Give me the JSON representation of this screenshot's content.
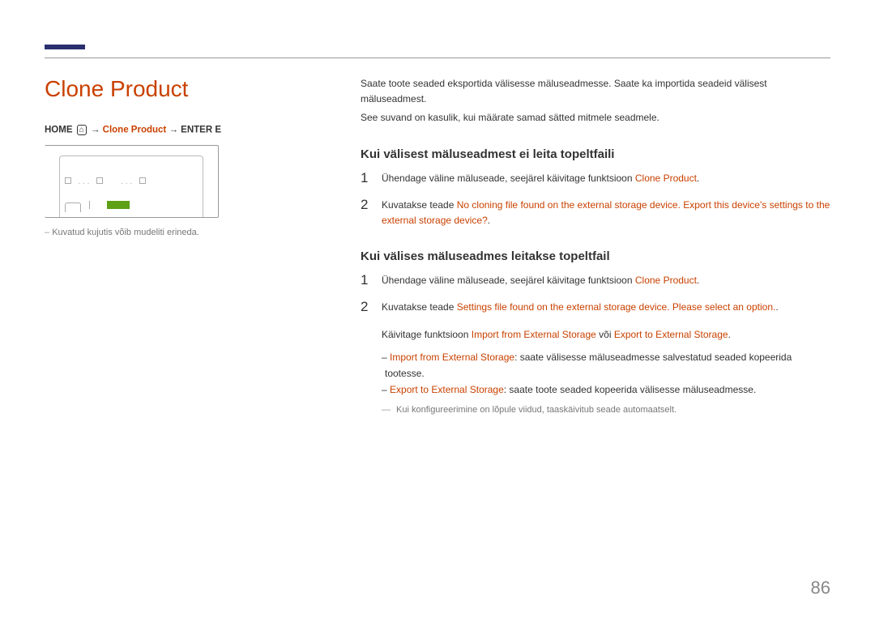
{
  "page_number": "86",
  "main_title": "Clone Product",
  "breadcrumb": {
    "home": "HOME",
    "clone_product": "Clone Product",
    "enter": "ENTER E"
  },
  "left_note": "Kuvatud kujutis võib mudeliti erineda.",
  "intro_line1": "Saate toote seaded eksportida välisesse mäluseadmesse. Saate ka importida seadeid välisest mäluseadmest.",
  "intro_line2": "See suvand on kasulik, kui määrate samad sätted mitmele seadmele.",
  "section1": {
    "heading": "Kui välisest mäluseadmest ei leita topeltfaili",
    "step1_pre": "Ühendage väline mäluseade, seejärel käivitage funktsioon ",
    "step1_orange": "Clone Product",
    "step1_post": ".",
    "step2_pre": "Kuvatakse teade ",
    "step2_orange": "No cloning file found on the external storage device. Export this device's settings to the external storage device?",
    "step2_post": "."
  },
  "section2": {
    "heading": "Kui välises mäluseadmes leitakse topeltfail",
    "step1_pre": "Ühendage väline mäluseade, seejärel käivitage funktsioon ",
    "step1_orange": "Clone Product",
    "step1_post": ".",
    "step2_pre": "Kuvatakse teade ",
    "step2_orange": "Settings file found on the external storage device. Please select an option.",
    "step2_post": ".",
    "run_text_pre": "Käivitage funktsioon ",
    "run_text_o1": "Import from External Storage",
    "run_text_mid": " või ",
    "run_text_o2": "Export to External Storage",
    "run_text_post": ".",
    "li1_o": "Import from External Storage",
    "li1_rest": ": saate välisesse mäluseadmesse salvestatud seaded kopeerida tootesse.",
    "li2_o": "Export to External Storage",
    "li2_rest": ": saate toote seaded kopeerida välisesse mäluseadmesse.",
    "dash_note": "Kui konfigureerimine on lõpule viidud, taaskäivitub seade automaatselt."
  }
}
